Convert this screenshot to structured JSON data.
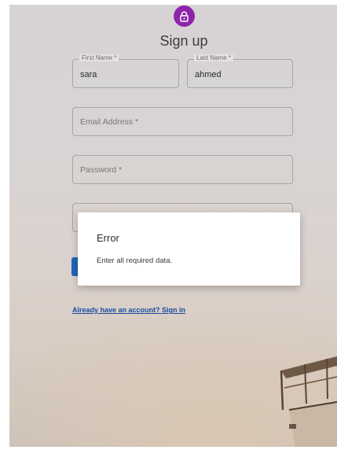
{
  "form": {
    "title": "Sign up",
    "first_name": {
      "label": "First Name *",
      "value": "sara"
    },
    "last_name": {
      "label": "Last Name *",
      "value": "ahmed"
    },
    "email": {
      "placeholder": "Email Address *"
    },
    "password": {
      "placeholder": "Password *"
    },
    "signin_link": "Already have an account? Sign in"
  },
  "dialog": {
    "title": "Error",
    "message": "Enter all required data."
  },
  "colors": {
    "avatar": "#8e24aa",
    "primary_button": "#1f64b8",
    "link": "#1a4fa0"
  },
  "icons": {
    "avatar": "lock-icon"
  }
}
